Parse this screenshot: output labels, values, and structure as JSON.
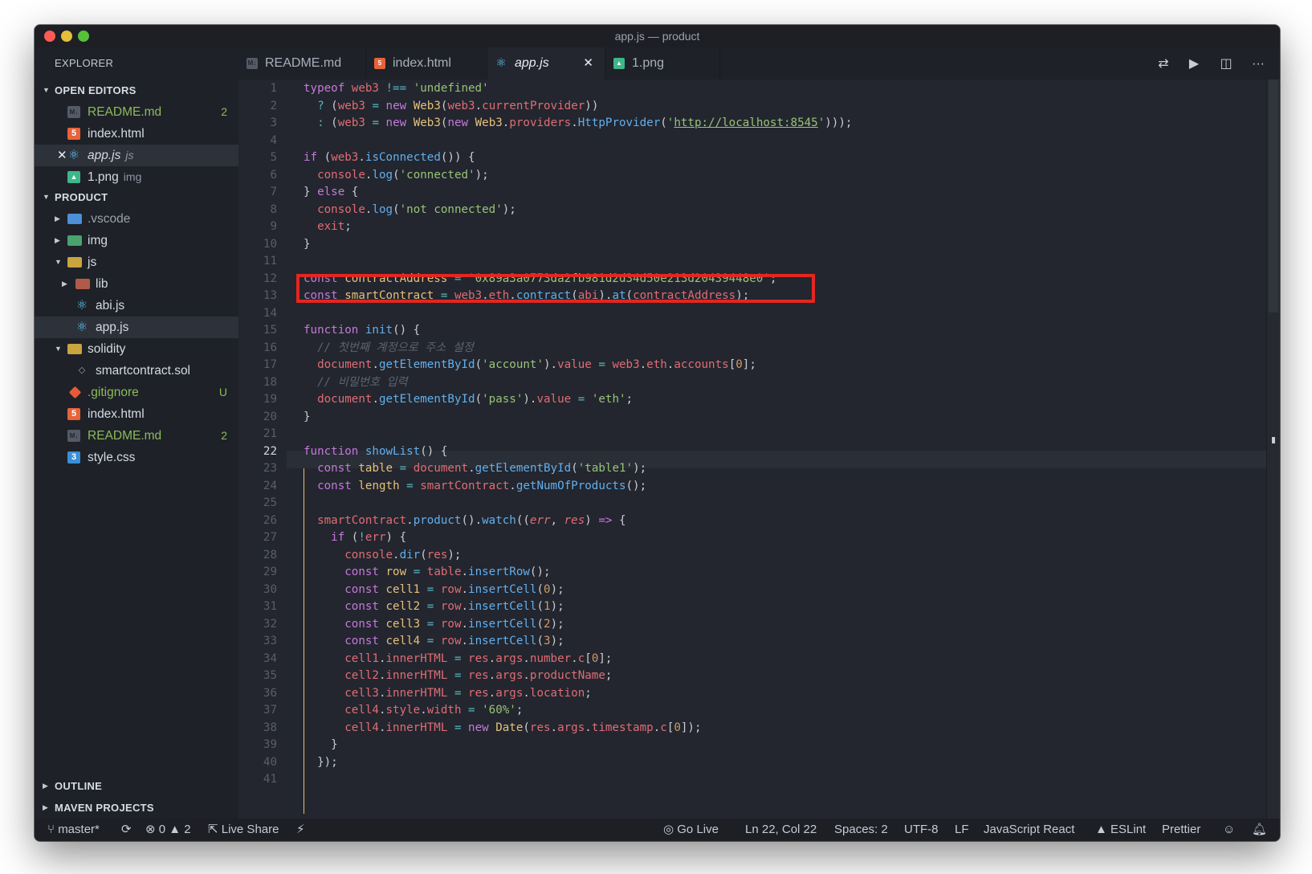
{
  "window": {
    "title": "app.js — product"
  },
  "sidebar": {
    "title": "EXPLORER",
    "open_editors_title": "OPEN EDITORS",
    "open_editors": [
      {
        "label": "README.md",
        "badge": "2",
        "color": "#8cbb5a"
      },
      {
        "label": "index.html",
        "badge": ""
      },
      {
        "label": "app.js",
        "sub": "js",
        "badge": ""
      },
      {
        "label": "1.png",
        "sub": "img",
        "badge": ""
      }
    ],
    "project_title": "PRODUCT",
    "tree": [
      {
        "label": ".vscode",
        "color": "#9ba1ad"
      },
      {
        "label": "img"
      },
      {
        "label": "js"
      },
      {
        "label": "lib"
      },
      {
        "label": "abi.js"
      },
      {
        "label": "app.js"
      },
      {
        "label": "solidity"
      },
      {
        "label": "smartcontract.sol"
      },
      {
        "label": ".gitignore",
        "badge": "U",
        "color": "#8cbb5a"
      },
      {
        "label": "index.html"
      },
      {
        "label": "README.md",
        "badge": "2",
        "color": "#8cbb5a"
      },
      {
        "label": "style.css"
      }
    ],
    "outline_title": "OUTLINE",
    "maven_title": "MAVEN PROJECTS"
  },
  "tabs": [
    {
      "label": "README.md"
    },
    {
      "label": "index.html"
    },
    {
      "label": "app.js",
      "active": true
    },
    {
      "label": "1.png"
    }
  ],
  "editor": {
    "current_line": 22,
    "line_numbers": [
      "1",
      "2",
      "3",
      "4",
      "5",
      "6",
      "7",
      "8",
      "9",
      "10",
      "11",
      "12",
      "13",
      "14",
      "15",
      "16",
      "17",
      "18",
      "19",
      "20",
      "21",
      "22",
      "23",
      "24",
      "25",
      "26",
      "27",
      "28",
      "29",
      "30",
      "31",
      "32",
      "33",
      "34",
      "35",
      "36",
      "37",
      "38",
      "39",
      "40",
      "41"
    ],
    "comment_1": "// 첫번째 계정으로 주소 설정",
    "comment_2": "// 비밀번호 입력",
    "contract_address": "'0x89a3a0773da2fb981d2d34d50e213d20439448e0'",
    "provider_url": "http://localhost:8545"
  },
  "statusbar": {
    "branch": "master*",
    "errors": "0",
    "warnings": "2",
    "live_share": "Live Share",
    "go_live": "Go Live",
    "position": "Ln 22, Col 22",
    "spaces": "Spaces: 2",
    "encoding": "UTF-8",
    "eol": "LF",
    "language": "JavaScript React",
    "eslint": "ESLint",
    "prettier": "Prettier"
  },
  "colors": {
    "accent_highlight": "#e32621",
    "background": "#23262e"
  }
}
